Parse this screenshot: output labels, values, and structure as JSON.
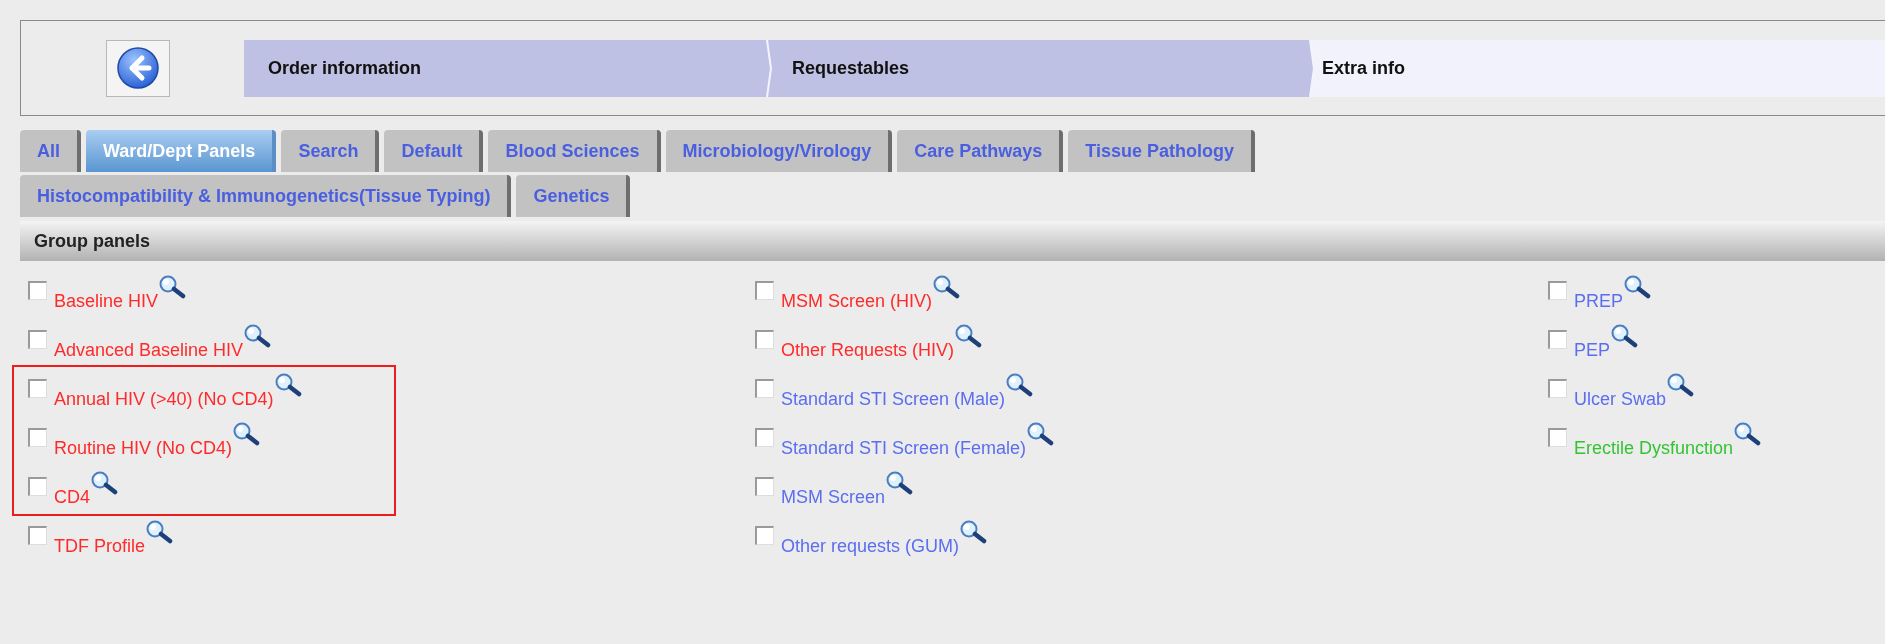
{
  "breadcrumb": [
    {
      "label": "Order information",
      "selected": false
    },
    {
      "label": "Requestables",
      "selected": false
    },
    {
      "label": "Extra info",
      "selected": true
    }
  ],
  "tab_rows": [
    [
      {
        "label": "All",
        "selected": false
      },
      {
        "label": "Ward/Dept Panels",
        "selected": true
      },
      {
        "label": "Search",
        "selected": false
      },
      {
        "label": "Default",
        "selected": false
      },
      {
        "label": "Blood Sciences",
        "selected": false
      },
      {
        "label": "Microbiology/Virology",
        "selected": false
      },
      {
        "label": "Care Pathways",
        "selected": false
      },
      {
        "label": "Tissue Pathology",
        "selected": false
      }
    ],
    [
      {
        "label": "Histocompatibility & Immunogenetics(Tissue Typing)",
        "selected": false
      },
      {
        "label": "Genetics",
        "selected": false
      }
    ]
  ],
  "section": {
    "title": "Group panels"
  },
  "panel_columns": [
    [
      {
        "label": "Baseline HIV",
        "checked": false,
        "color": "#ff2a2a",
        "highlighted": false
      },
      {
        "label": "Advanced Baseline HIV",
        "checked": false,
        "color": "#ff2a2a",
        "highlighted": false
      },
      {
        "label": "Annual HIV (>40) (No CD4)",
        "checked": false,
        "color": "#ff2a2a",
        "highlighted": true
      },
      {
        "label": "Routine HIV (No CD4)",
        "checked": false,
        "color": "#ff2a2a",
        "highlighted": true
      },
      {
        "label": "CD4",
        "checked": false,
        "color": "#ff2a2a",
        "highlighted": true
      },
      {
        "label": "TDF Profile",
        "checked": false,
        "color": "#ff2a2a",
        "highlighted": false
      }
    ],
    [
      {
        "label": "MSM Screen (HIV)",
        "checked": false,
        "color": "#ff2a2a",
        "highlighted": false
      },
      {
        "label": "Other Requests (HIV)",
        "checked": false,
        "color": "#ff2a2a",
        "highlighted": false
      },
      {
        "label": "Standard STI Screen (Male)",
        "checked": false,
        "color": "#5b6ef0",
        "highlighted": false
      },
      {
        "label": "Standard STI Screen (Female)",
        "checked": false,
        "color": "#5b6ef0",
        "highlighted": false
      },
      {
        "label": "MSM Screen",
        "checked": false,
        "color": "#5b6ef0",
        "highlighted": false
      },
      {
        "label": "Other requests (GUM)",
        "checked": false,
        "color": "#5b6ef0",
        "highlighted": false
      }
    ],
    [
      {
        "label": "PREP",
        "checked": false,
        "color": "#5b6ef0",
        "highlighted": false
      },
      {
        "label": "PEP",
        "checked": false,
        "color": "#5b6ef0",
        "highlighted": false
      },
      {
        "label": "Ulcer Swab",
        "checked": false,
        "color": "#5b6ef0",
        "highlighted": false
      },
      {
        "label": "Erectile Dysfunction",
        "checked": false,
        "color": "#33c433",
        "highlighted": false
      }
    ]
  ]
}
